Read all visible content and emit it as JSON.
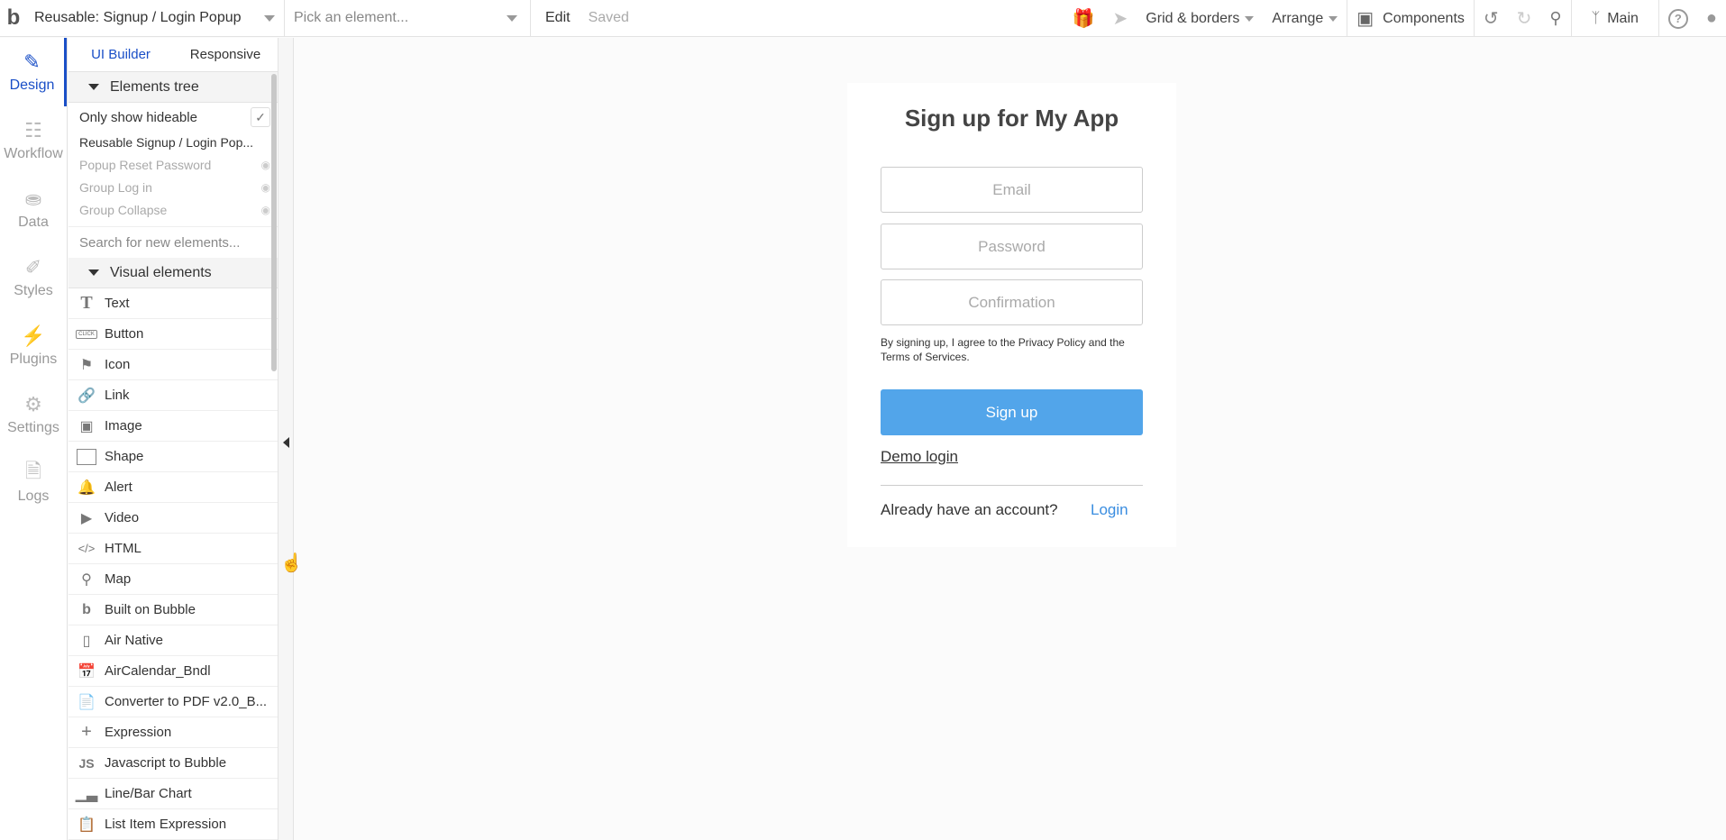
{
  "topbar": {
    "logo": "b",
    "page_name": "Reusable: Signup / Login Popup",
    "element_placeholder": "Pick an element...",
    "edit": "Edit",
    "saved": "Saved",
    "grid_borders": "Grid & borders",
    "arrange": "Arrange",
    "components": "Components",
    "branch": "Main"
  },
  "nav": {
    "items": [
      {
        "label": "Design",
        "icon": "design-icon"
      },
      {
        "label": "Workflow",
        "icon": "workflow-icon"
      },
      {
        "label": "Data",
        "icon": "database-icon"
      },
      {
        "label": "Styles",
        "icon": "brush-icon"
      },
      {
        "label": "Plugins",
        "icon": "plug-icon"
      },
      {
        "label": "Settings",
        "icon": "gear-icon"
      },
      {
        "label": "Logs",
        "icon": "logs-icon"
      }
    ]
  },
  "panel": {
    "tabs": [
      "UI Builder",
      "Responsive"
    ],
    "tree_header": "Elements tree",
    "only_show_hideable": "Only show hideable",
    "tree_root": "Reusable Signup / Login Pop...",
    "tree_items": [
      "Popup Reset Password",
      "Group Log in",
      "Group Collapse"
    ],
    "search_placeholder": "Search for new elements...",
    "visual_header": "Visual elements",
    "elements": [
      "Text",
      "Button",
      "Icon",
      "Link",
      "Image",
      "Shape",
      "Alert",
      "Video",
      "HTML",
      "Map",
      "Built on Bubble",
      "Air Native",
      "AirCalendar_Bndl",
      "Converter to PDF v2.0_B...",
      "Expression",
      "Javascript to Bubble",
      "Line/Bar Chart",
      "List Item Expression"
    ]
  },
  "canvas": {
    "title": "Sign up for My App",
    "email_placeholder": "Email",
    "password_placeholder": "Password",
    "confirmation_placeholder": "Confirmation",
    "terms": "By signing up, I agree to the Privacy Policy and the Terms of Services.",
    "signup_button": "Sign up",
    "demo_login": "Demo login",
    "have_account": "Already have an account?",
    "login": "Login"
  },
  "colors": {
    "accent": "#1a4fc7",
    "button": "#52a5ea",
    "link": "#3a8de0"
  }
}
